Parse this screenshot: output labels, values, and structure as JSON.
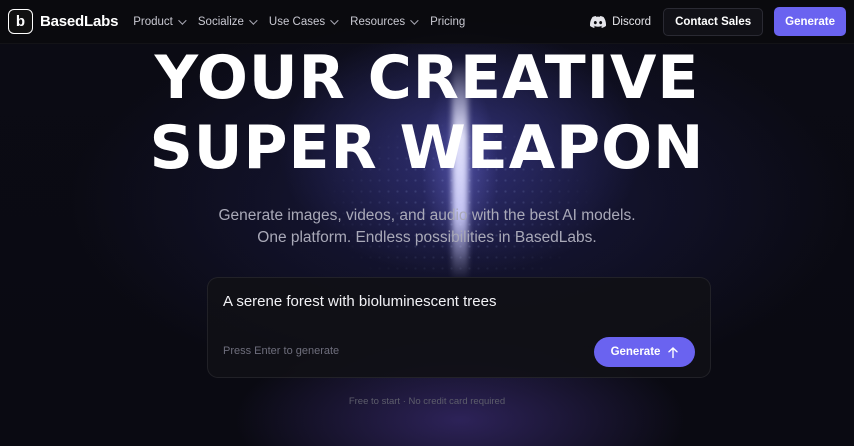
{
  "brand": {
    "name": "BasedLabs",
    "logo_letter": "b"
  },
  "nav": {
    "items": [
      {
        "label": "Product",
        "dropdown": true
      },
      {
        "label": "Socialize",
        "dropdown": true
      },
      {
        "label": "Use Cases",
        "dropdown": true
      },
      {
        "label": "Resources",
        "dropdown": true
      },
      {
        "label": "Pricing",
        "dropdown": false
      }
    ],
    "discord_label": "Discord",
    "contact_label": "Contact Sales",
    "generate_label": "Generate"
  },
  "hero": {
    "headline_line1": "YOUR CREATIVE",
    "headline_line2": "SUPER WEAPON",
    "subtitle_line1": "Generate images, videos, and audio with the best AI models.",
    "subtitle_line2": "One platform. Endless possibilities in BasedLabs."
  },
  "prompt": {
    "value": "A serene forest with bioluminescent trees",
    "hint": "Press Enter to generate",
    "generate_label": "Generate"
  },
  "footnote": "Free to start · No credit card required",
  "colors": {
    "accent": "#6a63f0",
    "background": "#0a0a10"
  }
}
